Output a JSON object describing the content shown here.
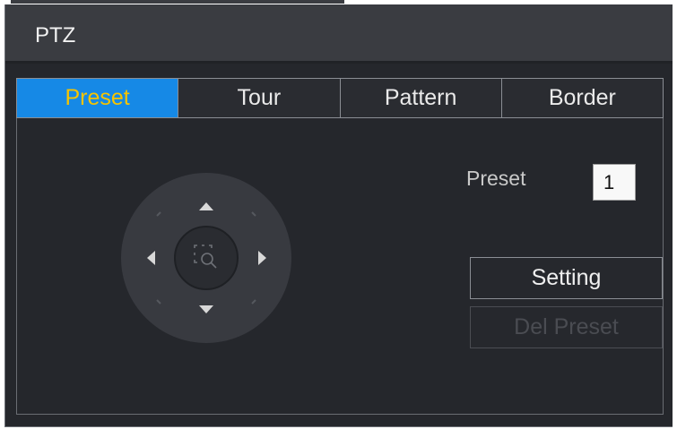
{
  "window": {
    "title": "PTZ"
  },
  "tabs": [
    {
      "label": "Preset",
      "active": true
    },
    {
      "label": "Tour",
      "active": false
    },
    {
      "label": "Pattern",
      "active": false
    },
    {
      "label": "Border",
      "active": false
    }
  ],
  "preset": {
    "label": "Preset",
    "value": "1"
  },
  "buttons": {
    "setting_label": "Setting",
    "del_preset_label": "Del Preset"
  },
  "dpad": {
    "icons": [
      "arrow-up-icon",
      "arrow-down-icon",
      "arrow-left-icon",
      "arrow-right-icon",
      "zoom-magnifier-icon"
    ]
  },
  "colors": {
    "active_tab_bg": "#1689e6",
    "active_tab_text": "#f6c400",
    "background": "#25272c",
    "title_bar": "#3a3c41"
  }
}
